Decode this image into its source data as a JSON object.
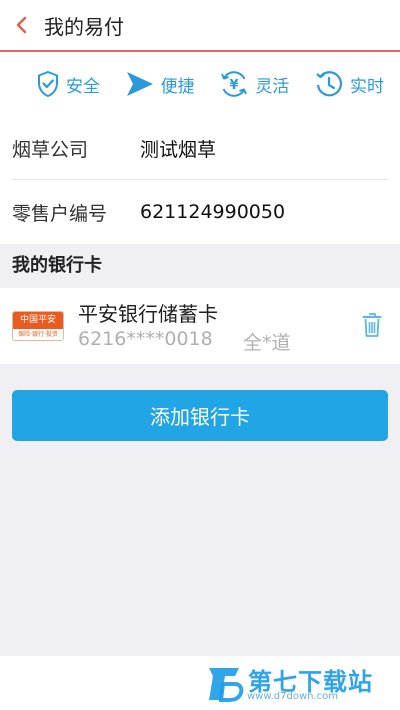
{
  "header": {
    "title": "我的易付",
    "back_icon": "chevron-left-icon",
    "accent_color": "#e06a6a"
  },
  "features": [
    {
      "label": "安全",
      "icon": "shield-check-icon"
    },
    {
      "label": "便捷",
      "icon": "send-arrow-icon"
    },
    {
      "label": "灵活",
      "icon": "yen-arrows-icon"
    },
    {
      "label": "实时",
      "icon": "clock-history-icon"
    }
  ],
  "info": {
    "company_label": "烟草公司",
    "company_value": "测试烟草",
    "retailer_label": "零售户编号",
    "retailer_value": "621124990050"
  },
  "bank_section": {
    "title": "我的银行卡",
    "card": {
      "logo_text": "中国平安",
      "logo_subtext": "保险·银行·投资",
      "bank_name": "平安银行储蓄卡",
      "card_number": "6216****0018",
      "card_holder": "全*道",
      "delete_icon": "trash-icon"
    }
  },
  "add_card_button": {
    "label": "添加银行卡",
    "color": "#22a5e4"
  },
  "watermark": {
    "title": "第七下载站",
    "url": "www.d7down.com"
  }
}
